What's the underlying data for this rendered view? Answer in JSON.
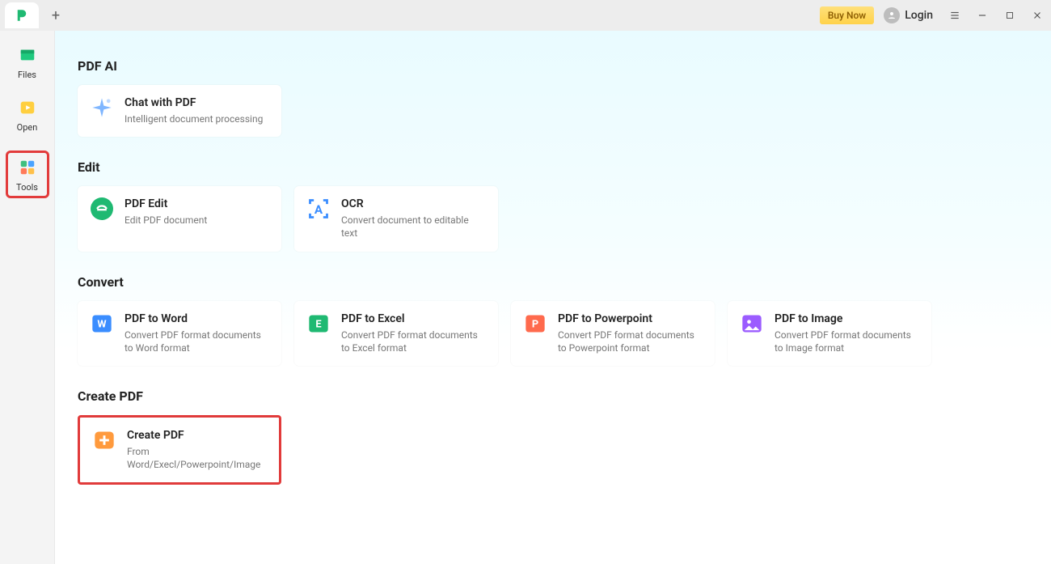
{
  "titlebar": {
    "buyNow": "Buy Now",
    "login": "Login"
  },
  "sidebar": {
    "files": "Files",
    "open": "Open",
    "tools": "Tools"
  },
  "sections": {
    "pdfAi": {
      "title": "PDF AI",
      "chat": {
        "title": "Chat with PDF",
        "sub": "Intelligent document processing"
      }
    },
    "edit": {
      "title": "Edit",
      "pdfEdit": {
        "title": "PDF Edit",
        "sub": "Edit PDF document"
      },
      "ocr": {
        "title": "OCR",
        "sub": "Convert document to editable text"
      }
    },
    "convert": {
      "title": "Convert",
      "word": {
        "title": "PDF to Word",
        "sub": "Convert PDF format documents to Word format"
      },
      "excel": {
        "title": "PDF to Excel",
        "sub": "Convert PDF format documents to Excel format"
      },
      "ppt": {
        "title": "PDF to Powerpoint",
        "sub": "Convert PDF format documents to Powerpoint format"
      },
      "image": {
        "title": "PDF to Image",
        "sub": "Convert PDF format documents to Image format"
      }
    },
    "create": {
      "title": "Create PDF",
      "createPdf": {
        "title": "Create PDF",
        "sub": "From Word/Execl/Powerpoint/Image"
      }
    }
  }
}
